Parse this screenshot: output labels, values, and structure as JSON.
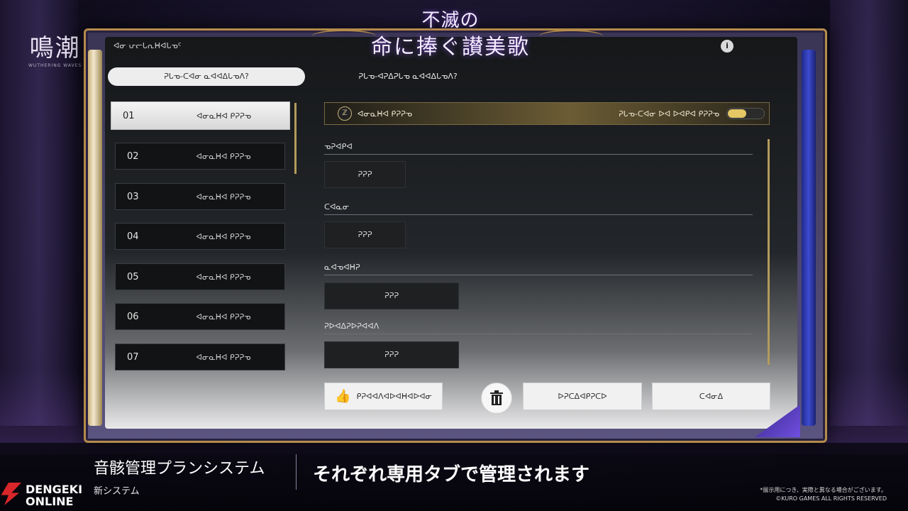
{
  "brand": {
    "logo_text": "鳴潮",
    "logo_sub": "WUTHERING WAVES"
  },
  "title_logo": {
    "line1": "不滅の",
    "line2": "命に捧ぐ讃美歌"
  },
  "panel": {
    "header": "ᐊᓂ ᕂᓕᒐᕆᕼᐊᒐᓀᑦ",
    "info_icon": "info-icon",
    "tabs": [
      {
        "label": "ᕈᒐᓀ-ᑕᐊᓂ ᓇᐊᐊᐃᒐᓀᐱ?",
        "active": true
      },
      {
        "label": "ᕈᒐᓀ-ᐊᕈᐃᕈᒐᓀ ᓇᐊᐊᐃᒐᓀᐱ?",
        "active": false
      }
    ],
    "slots": [
      {
        "num": "01",
        "name": "ᐊᓂᓇᕼᐊ ᑭᕈᕈᓀ",
        "active": true
      },
      {
        "num": "02",
        "name": "ᐊᓂᓇᕼᐊ ᑭᕈᕈᓀ",
        "active": false
      },
      {
        "num": "03",
        "name": "ᐊᓂᓇᕼᐊ ᑭᕈᕈᓀ",
        "active": false
      },
      {
        "num": "04",
        "name": "ᐊᓂᓇᕼᐊ ᑭᕈᕈᓀ",
        "active": false
      },
      {
        "num": "05",
        "name": "ᐊᓂᓇᕼᐊ ᑭᕈᕈᓀ",
        "active": false
      },
      {
        "num": "06",
        "name": "ᐊᓂᓇᕼᐊ ᑭᕈᕈᓀ",
        "active": false
      },
      {
        "num": "07",
        "name": "ᐊᓂᓇᕼᐊ ᑭᕈᕈᓀ",
        "active": false
      }
    ],
    "top_bar": {
      "char_icon": "ℤ",
      "label": "ᐊᓂᓇᕼᐊ ᑭᕈᕈᓀ",
      "toggle_label": "ᕈᒐᓀ-ᑕᐊᓂ ᐅᐊ ᐅᐊᑭᐊ ᑭᕈᕈᓀ",
      "toggle_on": true
    },
    "sections": [
      {
        "label": "ᓀᕈᐊᑭᐊ",
        "value": "ᕈᕈᕈ"
      },
      {
        "label": "ᑕᐊᓇᓂ",
        "value": "ᕈᕈᕈ"
      },
      {
        "label": "ᓇᐊᓀᐊᕼᕈ",
        "value": "ᕈᕈᕈ"
      },
      {
        "label": "ᕈᐅᐊᐃᕈᐅᕈᐊᐊᐱ",
        "value": "ᕈᕈᕈ"
      }
    ],
    "buttons": {
      "equip": "ᑭᕈᐊᐊᐱᐊᐅᐊᕼᐊᐅᐊᓂ",
      "trash_icon": "trash-icon",
      "rename": "ᐅᕈᑕᐃᐊᑭᕈᑕᐅ",
      "save": "ᑕᐊᓂᐃ"
    }
  },
  "caption": {
    "title": "音骸管理プランシステム",
    "subtitle": "新システム",
    "main": "それぞれ専用タブで管理されます",
    "disclaimer_line1": "*展示用につき、実際と異なる場合がございます。",
    "disclaimer_line2": "©KURO GAMES ALL RIGHTS RESERVED"
  },
  "watermark": {
    "line1": "DENGEKI",
    "line2": "ONLINE"
  },
  "colors": {
    "accent_gold": "#b48b4a",
    "toggle_on": "#e5c766",
    "frame_blue": "#3d4bd0"
  }
}
